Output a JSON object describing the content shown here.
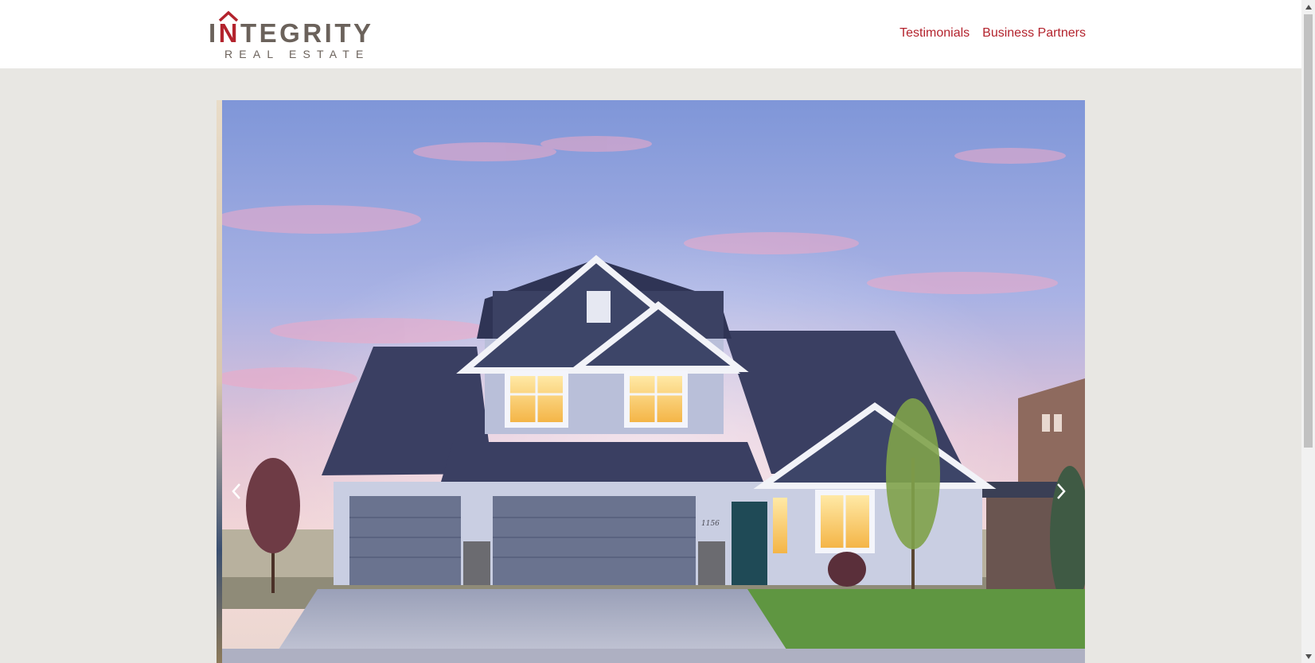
{
  "brand": {
    "name_prefix": "I",
    "name_highlight": "N",
    "name_rest": "TEGRITY",
    "tagline": "REAL ESTATE",
    "colors": {
      "accent": "#b3232d",
      "brand_gray": "#6b625b",
      "page_background": "#e8e7e3",
      "header_background": "#ffffff"
    }
  },
  "nav": {
    "items": [
      {
        "label": "Testimonials"
      },
      {
        "label": "Business Partners"
      }
    ]
  },
  "carousel": {
    "house_number": "1156",
    "controls": {
      "prev_icon": "chevron-left-icon",
      "next_icon": "chevron-right-icon"
    }
  }
}
